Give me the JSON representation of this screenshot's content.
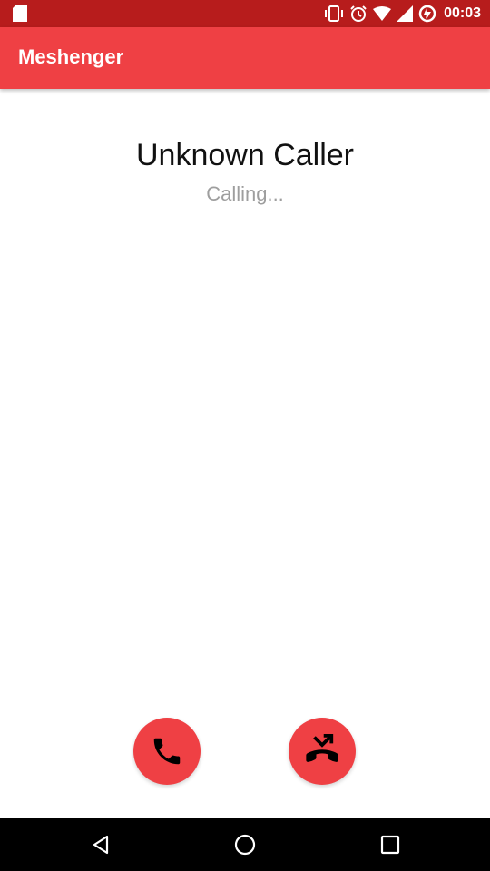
{
  "status_bar": {
    "time": "00:03",
    "icons": [
      "sd-card-icon",
      "vibrate-icon",
      "alarm-icon",
      "wifi-icon",
      "signal-icon",
      "data-saver-icon"
    ]
  },
  "app_bar": {
    "title": "Meshenger"
  },
  "call": {
    "caller_name": "Unknown Caller",
    "status": "Calling...",
    "accept_icon": "phone-icon",
    "decline_icon": "call-end-icon"
  },
  "nav_bar": {
    "icons": [
      "back-icon",
      "home-icon",
      "recents-icon"
    ]
  },
  "colors": {
    "status_bar": "#b71c1c",
    "accent": "#ef4044",
    "caller_text": "#111111",
    "status_text": "#9e9e9e",
    "nav_bar": "#000000"
  }
}
